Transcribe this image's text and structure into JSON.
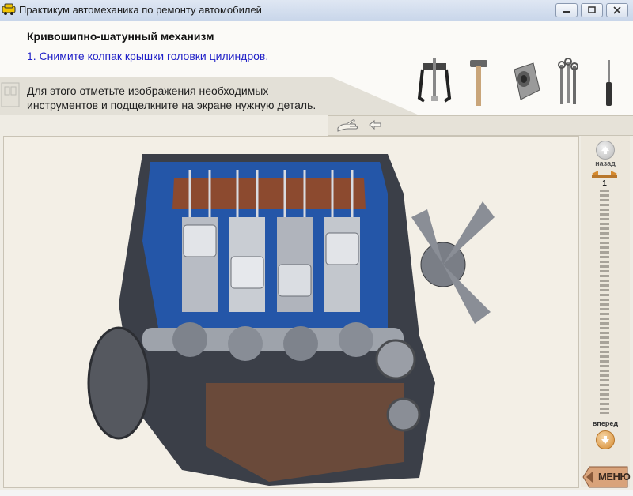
{
  "window": {
    "title": "Практикум автомеханика по ремонту автомобилей",
    "controls": [
      "minimize-icon",
      "maximize-icon",
      "close-icon"
    ]
  },
  "lesson": {
    "topic": "Кривошипно-шатунный механизм",
    "step": "1. Снимите колпак крышки головки цилиндров.",
    "instruction_line1": "Для этого отметьте изображения необходимых",
    "instruction_line2": "инструментов и подщелкните на экране нужную деталь."
  },
  "tools": [
    {
      "name": "puller-icon"
    },
    {
      "name": "hammer-icon"
    },
    {
      "name": "socket-head-icon"
    },
    {
      "name": "wrench-set-icon"
    },
    {
      "name": "screwdriver-icon"
    }
  ],
  "toolbar": {
    "hand_icon": "hand-pointer-icon",
    "back_icon": "arrow-left-icon"
  },
  "navigation": {
    "back_label": "назад",
    "forward_label": "вперед",
    "current_step": "1",
    "menu_label": "МЕНЮ"
  },
  "colors": {
    "step_text": "#2121c8",
    "engine_coolant_blue": "#2456a8",
    "accent_orange": "#d58a2f"
  }
}
